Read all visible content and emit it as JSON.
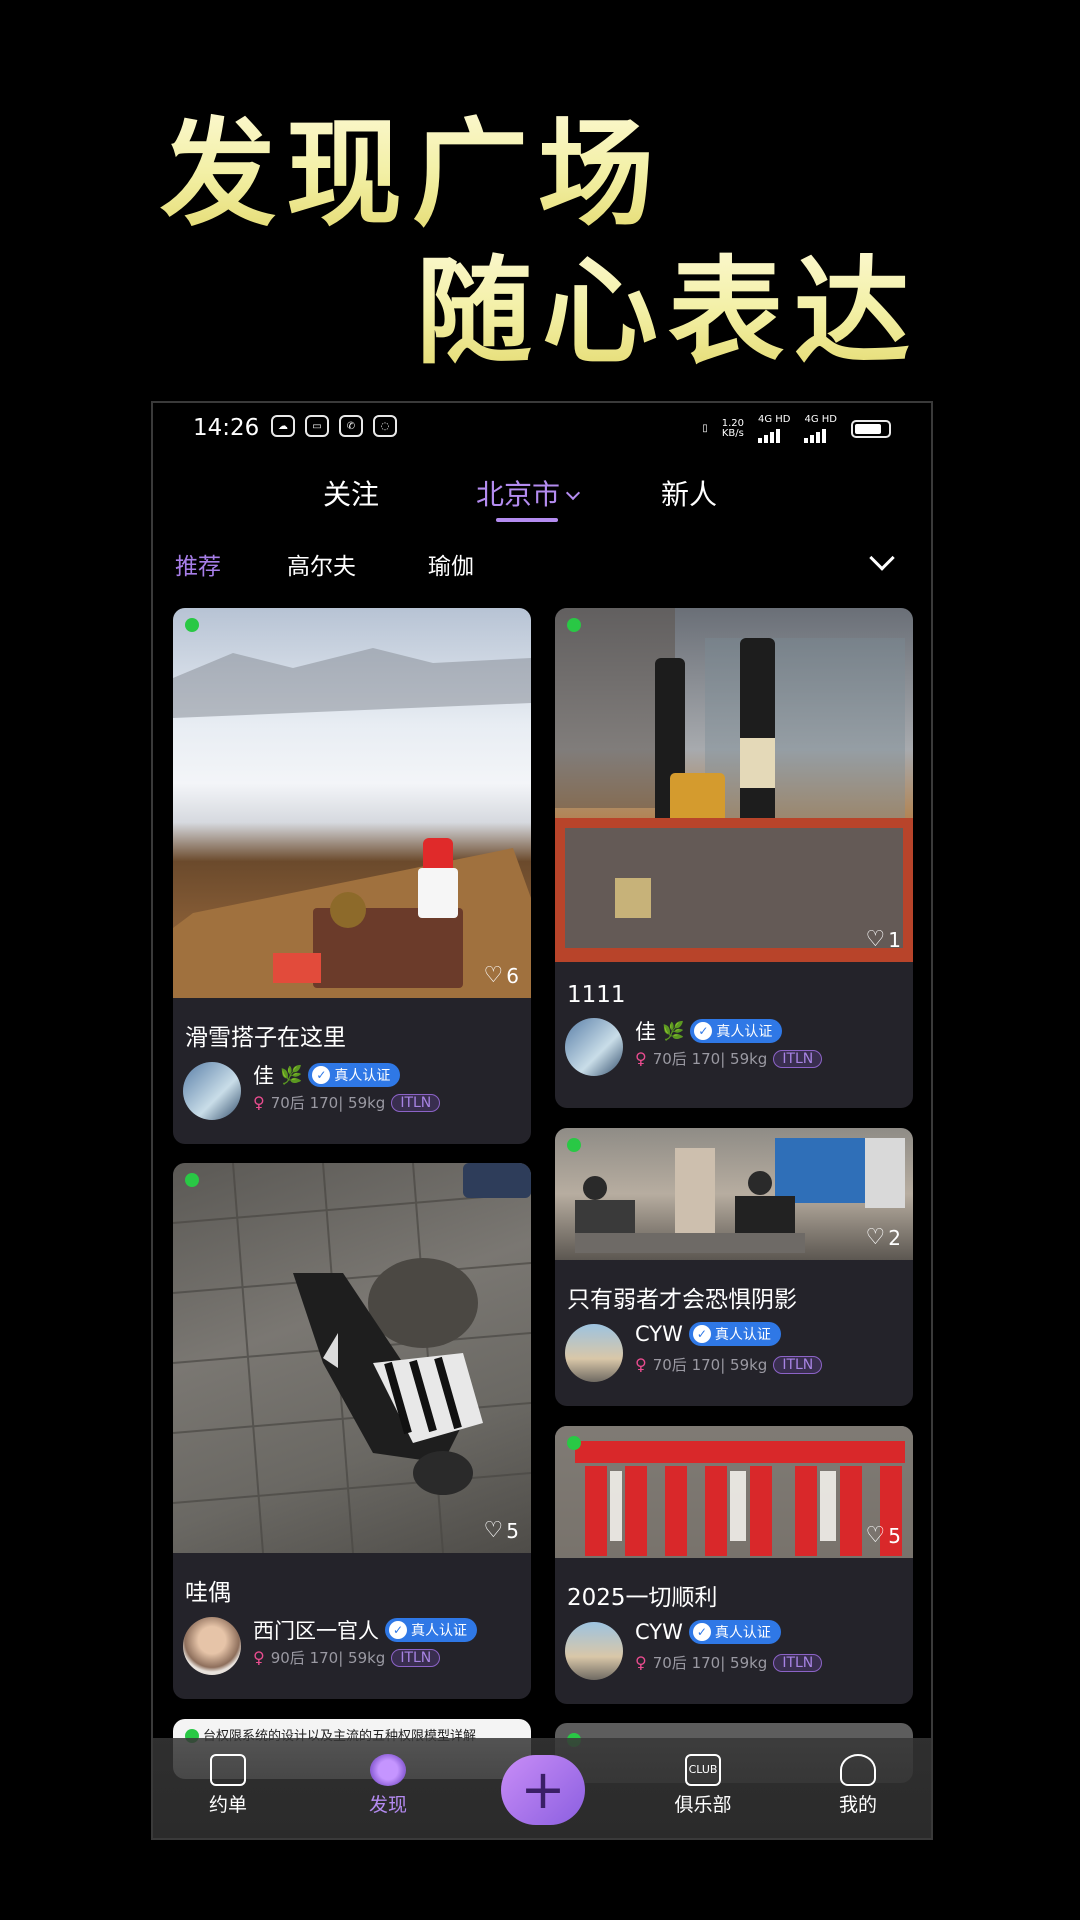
{
  "promo": {
    "line1": "发现广场",
    "line2": "随心表达"
  },
  "statusbar": {
    "time": "14:26",
    "net_speed": "1.20",
    "net_unit": "KB/s",
    "network1": "4G HD",
    "network2": "4G HD"
  },
  "topnav": {
    "follow": "关注",
    "city": "北京市",
    "newbie": "新人"
  },
  "categories": [
    "推荐",
    "高尔夫",
    "瑜伽"
  ],
  "posts": [
    {
      "title": "滑雪搭子在这里",
      "likes": "6",
      "author": "佳",
      "verified_label": "真人认证",
      "info": "70后 170| 59kg",
      "tag": "ITLN"
    },
    {
      "title": "1111",
      "likes": "1",
      "author": "佳",
      "verified_label": "真人认证",
      "info": "70后 170| 59kg",
      "tag": "ITLN"
    },
    {
      "title": "只有弱者才会恐惧阴影",
      "likes": "2",
      "author": "CYW",
      "verified_label": "真人认证",
      "info": "70后 170| 59kg",
      "tag": "ITLN"
    },
    {
      "title": "哇偶",
      "likes": "5",
      "author": "西门区一官人",
      "verified_label": "真人认证",
      "info": "90后 170| 59kg",
      "tag": "ITLN"
    },
    {
      "title": "2025一切顺利",
      "likes": "5",
      "author": "CYW",
      "verified_label": "真人认证",
      "info": "70后 170| 59kg",
      "tag": "ITLN"
    }
  ],
  "peek_card_text": "台权限系统的设计以及主流的五种权限模型详解",
  "tabbar": {
    "orders": "约单",
    "discover": "发现",
    "club": "俱乐部",
    "mine": "我的",
    "club_icon_text": "CLUB"
  },
  "colors": {
    "accent": "#b48cf0",
    "online": "#29c845",
    "verify": "#2f78e6",
    "card_bg": "#24232a"
  }
}
